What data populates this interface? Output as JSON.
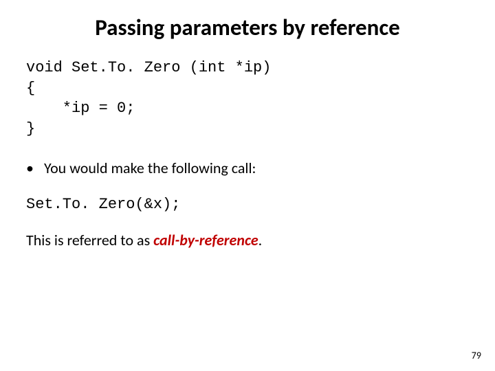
{
  "title": "Passing parameters by reference",
  "code": {
    "l1": "void Set.To. Zero (int *ip)",
    "l2": "{",
    "l3": "    *ip = 0;",
    "l4": "}"
  },
  "bullet": {
    "dot": "•",
    "text": "You would make the following call:"
  },
  "call_line": "Set.To. Zero(&x);",
  "para": {
    "before": "This is referred to as ",
    "term": "call-by-reference",
    "after": "."
  },
  "page_number": "79"
}
